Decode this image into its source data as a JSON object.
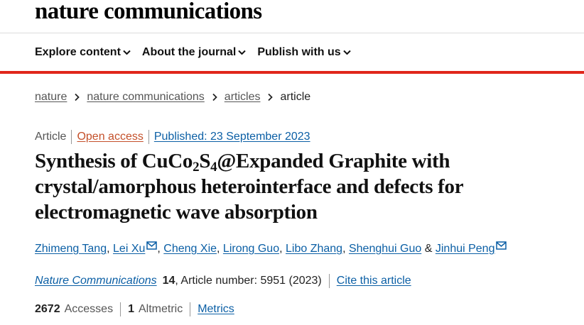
{
  "header": {
    "logo": "nature communications",
    "nav": [
      {
        "label": "Explore content"
      },
      {
        "label": "About the journal"
      },
      {
        "label": "Publish with us"
      }
    ]
  },
  "breadcrumb": {
    "items": [
      "nature",
      "nature communications",
      "articles"
    ],
    "current": "article"
  },
  "article": {
    "type": "Article",
    "access": "Open access",
    "published": "Published: 23 September 2023",
    "title_part1": "Synthesis of CuCo",
    "title_sub1": "2",
    "title_part2": "S",
    "title_sub2": "4",
    "title_part3": "@Expanded Graphite with crystal/amorphous heterointerface and defects for electromagnetic wave absorption",
    "authors": [
      "Zhimeng Tang",
      "Lei Xu",
      "Cheng Xie",
      "Lirong Guo",
      "Libo Zhang",
      "Shenghui Guo",
      "Jinhui Peng"
    ],
    "author_sep": ",",
    "author_last_sep": "&",
    "journal": "Nature Communications",
    "volume": "14",
    "article_number": ", Article number: 5951 (2023)",
    "cite": "Cite this article",
    "accesses_count": "2672",
    "accesses_label": "Accesses",
    "altmetric_count": "1",
    "altmetric_label": "Altmetric",
    "metrics_link": "Metrics"
  },
  "colors": {
    "accent_red": "#e0261b",
    "link_blue": "#0b5fa5",
    "open_access": "#c4502a"
  }
}
